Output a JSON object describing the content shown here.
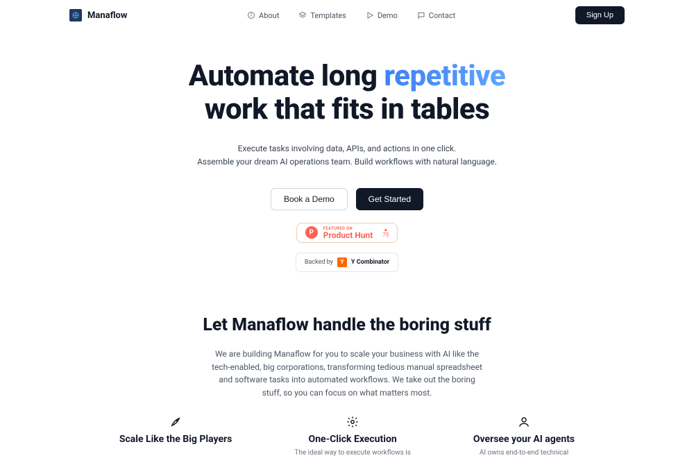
{
  "nav": {
    "brand": "Manaflow",
    "items": [
      {
        "label": "About"
      },
      {
        "label": "Templates"
      },
      {
        "label": "Demo"
      },
      {
        "label": "Contact"
      }
    ],
    "signup": "Sign Up"
  },
  "hero": {
    "title_part1": "Automate long ",
    "title_highlight": "repetitive",
    "title_part2": "work that fits in tables",
    "sub_line1": "Execute tasks involving data, APIs, and actions in one click.",
    "sub_line2": "Assemble your dream AI operations team. Build workflows with natural language.",
    "cta_outline": "Book a Demo",
    "cta_dark": "Get Started"
  },
  "product_hunt": {
    "featured": "FEATURED ON",
    "name": "Product Hunt",
    "upvotes": "75"
  },
  "backed_by": {
    "prefix": "Backed by",
    "name": "Y Combinator"
  },
  "section2": {
    "title": "Let Manaflow handle the boring stuff",
    "desc": "We are building Manaflow for you to scale your business with AI like the tech-enabled, big corporations, transforming tedious manual spreadsheet and software tasks into automated workflows. We take out the boring stuff, so you can focus on what matters most."
  },
  "features": [
    {
      "title": "Scale Like the Big Players",
      "desc": ""
    },
    {
      "title": "One-Click Execution",
      "desc": "The ideal way to execute workflows is"
    },
    {
      "title": "Oversee your AI agents",
      "desc": "AI owns end-to-end technical"
    }
  ]
}
